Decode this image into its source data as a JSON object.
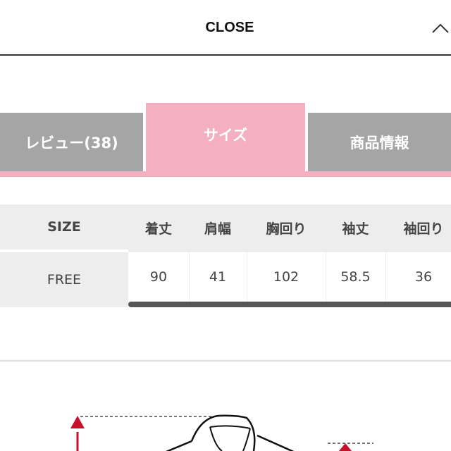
{
  "header": {
    "title": "CLOSE",
    "icon": "chevron-up-icon"
  },
  "tabs": [
    {
      "label": "レビュー(38)",
      "active": false
    },
    {
      "label": "サイズ",
      "active": true
    },
    {
      "label": "商品情報",
      "active": false
    }
  ],
  "colors": {
    "active_tab": "#f2b0c0",
    "inactive_tab": "#a5a5a5",
    "arrow": "#c8102e"
  },
  "size_table": {
    "headers": [
      "SIZE",
      "着丈",
      "肩幅",
      "胸回り",
      "袖丈",
      "袖回り"
    ],
    "rows": [
      [
        "FREE",
        "90",
        "41",
        "102",
        "58.5",
        "36"
      ]
    ]
  }
}
